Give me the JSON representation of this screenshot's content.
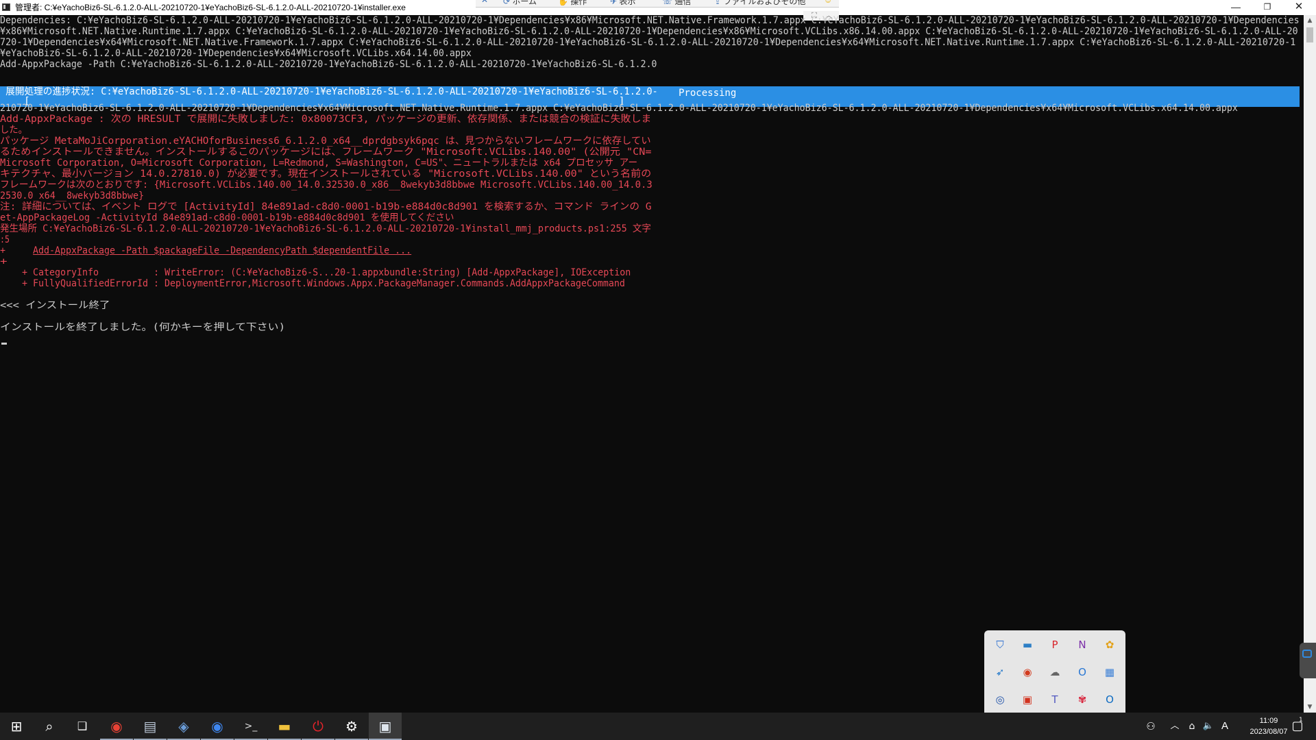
{
  "window": {
    "title": "管理者: C:¥eYachoBiz6-SL-6.1.2.0-ALL-20210720-1¥eYachoBiz6-SL-6.1.2.0-ALL-20210720-1¥installer.exe",
    "minimize_glyph": "—",
    "maximize_glyph": "❐",
    "close_glyph": "✕"
  },
  "remote_toolbar": {
    "items": [
      {
        "glyph": "✕",
        "label": ""
      },
      {
        "glyph": "⟳",
        "label": "ホーム"
      },
      {
        "glyph": "✋",
        "label": "操作"
      },
      {
        "glyph": "✈",
        "label": "表示"
      },
      {
        "glyph": "☏",
        "label": "通信"
      },
      {
        "glyph": "⇪",
        "label": "ファイルおよびその他"
      },
      {
        "glyph": "☺",
        "label": ""
      }
    ],
    "fullscreen_glyph": "⛶",
    "collapse_glyph": "︿"
  },
  "console": {
    "lines": [
      {
        "text": "Dependencies: C:¥eYachoBiz6-SL-6.1.2.0-ALL-20210720-1¥eYachoBiz6-SL-6.1.2.0-ALL-20210720-1¥Dependencies¥x86¥Microsoft.NET.Native.Framework.1.7.appx C:¥eYachoBiz6-SL-6.1.2.0-ALL-20210720-1¥eYachoBiz6-SL-6.1.2.0-ALL-20210720-1¥Dependencies",
        "color": "w"
      },
      {
        "text": "¥x86¥Microsoft.NET.Native.Runtime.1.7.appx C:¥eYachoBiz6-SL-6.1.2.0-ALL-20210720-1¥eYachoBiz6-SL-6.1.2.0-ALL-20210720-1¥Dependencies¥x86¥Microsoft.VCLibs.x86.14.00.appx C:¥eYachoBiz6-SL-6.1.2.0-ALL-20210720-1¥eYachoBiz6-SL-6.1.2.0-ALL-20",
        "color": "w"
      },
      {
        "text": "720-1¥Dependencies¥x64¥Microsoft.NET.Native.Framework.1.7.appx C:¥eYachoBiz6-SL-6.1.2.0-ALL-20210720-1¥eYachoBiz6-SL-6.1.2.0-ALL-20210720-1¥Dependencies¥x64¥Microsoft.NET.Native.Runtime.1.7.appx C:¥eYachoBiz6-SL-6.1.2.0-ALL-20210720-1",
        "color": "w"
      },
      {
        "text": "¥eYachoBiz6-SL-6.1.2.0-ALL-20210720-1¥Dependencies¥x64¥Microsoft.VCLibs.x64.14.00.appx",
        "color": "w"
      },
      {
        "text": "Add-AppxPackage -Path C:¥eYachoBiz6-SL-6.1.2.0-ALL-20210720-1¥eYachoBiz6-SL-6.1.2.0-ALL-20210720-1¥eYachoBiz6-SL-6.1.2.0",
        "color": "w"
      },
      {
        "text": "",
        "color": "w"
      },
      {
        "text": "",
        "color": "w"
      },
      {
        "text": "",
        "color": "w"
      },
      {
        "text": "210720-1¥eYachoBiz6-SL-6.1.2.0-ALL-20210720-1¥Dependencies¥x64¥Microsoft.NET.Native.Runtime.1.7.appx C:¥eYachoBiz6-SL-6.1.2.0-ALL-20210720-1¥eYachoBiz6-SL-6.1.2.0-ALL-20210720-1¥Dependencies¥x64¥Microsoft.VCLibs.x64.14.00.appx",
        "color": "w"
      },
      {
        "text": "Add-AppxPackage : 次の HRESULT で展開に失敗しました: 0x80073CF3, パッケージの更新、依存関係、または競合の検証に失敗しま",
        "color": "r"
      },
      {
        "text": "した。",
        "color": "r"
      },
      {
        "text": "パッケージ MetaMoJiCorporation.eYACHOforBusiness6_6.1.2.0_x64__dprdgbsyk6pqc は、見つからないフレームワークに依存してい",
        "color": "r"
      },
      {
        "text": "るためインストールできません。インストールするこのパッケージには、フレームワーク \"Microsoft.VCLibs.140.00\" (公開元 \"CN=",
        "color": "r"
      },
      {
        "text": "Microsoft Corporation, O=Microsoft Corporation, L=Redmond, S=Washington, C=US\"、ニュートラルまたは x64 プロセッサ アー",
        "color": "r"
      },
      {
        "text": "キテクチャ、最小バージョン 14.0.27810.0) が必要です。現在インストールされている \"Microsoft.VCLibs.140.00\" という名前の",
        "color": "r"
      },
      {
        "text": "フレームワークは次のとおりです: {Microsoft.VCLibs.140.00_14.0.32530.0_x86__8wekyb3d8bbwe Microsoft.VCLibs.140.00_14.0.3",
        "color": "r"
      },
      {
        "text": "2530.0_x64__8wekyb3d8bbwe}",
        "color": "r"
      },
      {
        "text": "注: 詳細については、イベント ログで [ActivityId] 84e891ad-c8d0-0001-b19b-e884d0c8d901 を検索するか、コマンド ラインの G",
        "color": "r"
      },
      {
        "text": "et-AppPackageLog -ActivityId 84e891ad-c8d0-0001-b19b-e884d0c8d901 を使用してください",
        "color": "r"
      },
      {
        "text": "発生場所 C:¥eYachoBiz6-SL-6.1.2.0-ALL-20210720-1¥eYachoBiz6-SL-6.1.2.0-ALL-20210720-1¥install_mmj_products.ps1:255 文字",
        "color": "r"
      },
      {
        "text": ":5",
        "color": "r"
      },
      {
        "text": "+     Add-AppxPackage -Path $packageFile -DependencyPath $dependentFile ...",
        "color": "r",
        "underline_from": 6
      },
      {
        "text": "+",
        "color": "r"
      },
      {
        "text": "    + CategoryInfo          : WriteError: (C:¥eYachoBiz6-S...20-1.appxbundle:String) [Add-AppxPackage], IOException",
        "color": "r"
      },
      {
        "text": "    + FullyQualifiedErrorId : DeploymentError,Microsoft.Windows.Appx.PackageManager.Commands.AddAppxPackageCommand",
        "color": "r"
      },
      {
        "text": "",
        "color": "w"
      },
      {
        "text": "<<< インストール終了",
        "color": "w"
      },
      {
        "text": "",
        "color": "w"
      },
      {
        "text": "インストールを終了しました。(何かキーを押して下さい)",
        "color": "w"
      }
    ],
    "progress": {
      "line1": " 展開処理の進捗状況: C:¥eYachoBiz6-SL-6.1.2.0-ALL-20210720-1¥eYachoBiz6-SL-6.1.2.0-ALL-20210720-1¥eYachoBiz6-SL-6.1.2.0-",
      "line2": "    [                                                                                                  ]",
      "status": "Processing",
      "color": "#2b8fe4"
    }
  },
  "scrollbar": {
    "up": "▲",
    "down": "▼"
  },
  "tray_popup": {
    "icons": [
      {
        "name": "defender-shield-icon",
        "glyph": "⛉",
        "color": "#2a6fd1"
      },
      {
        "name": "display-icon",
        "glyph": "▬",
        "color": "#2d7fc6"
      },
      {
        "name": "pdf-app-icon",
        "glyph": "P",
        "color": "#d8262d"
      },
      {
        "name": "onenote-icon",
        "glyph": "N",
        "color": "#7b2ea8"
      },
      {
        "name": "sync-app-icon",
        "glyph": "✿",
        "color": "#e3a21a"
      },
      {
        "name": "bird-app-icon",
        "glyph": "➶",
        "color": "#1c74c9"
      },
      {
        "name": "video-app-icon",
        "glyph": "◉",
        "color": "#d23b1e"
      },
      {
        "name": "cloud-drive-icon",
        "glyph": "☁",
        "color": "#666666"
      },
      {
        "name": "outlook-calendar-icon",
        "glyph": "O",
        "color": "#2a78d4"
      },
      {
        "name": "grid-app-icon",
        "glyph": "▦",
        "color": "#3a7fd6"
      },
      {
        "name": "network-app-icon",
        "glyph": "◎",
        "color": "#1b4fa8"
      },
      {
        "name": "gift-app-icon",
        "glyph": "▣",
        "color": "#d2321e"
      },
      {
        "name": "teams-icon",
        "glyph": "T",
        "color": "#5158c0"
      },
      {
        "name": "flower-app-icon",
        "glyph": "✾",
        "color": "#d8243c"
      },
      {
        "name": "outlook-icon",
        "glyph": "O",
        "color": "#0f6cc2"
      },
      {
        "name": "remote-app-icon",
        "glyph": "⊟",
        "color": "#0d5c9e"
      },
      {
        "name": "wechat-icon",
        "glyph": "●",
        "color": "#2ec45a"
      },
      {
        "name": "bluetooth-icon",
        "glyph": "ᛒ",
        "color": "#1f6fd0"
      },
      {
        "name": "update-icon",
        "glyph": "◌",
        "color": "#3a8fde"
      }
    ]
  },
  "taskbar": {
    "start_glyph": "⊞",
    "search_glyph": "⌕",
    "taskview_glyph": "❑",
    "apps": [
      {
        "name": "chrome-taskbar-icon",
        "glyph": "◉",
        "color": "#e94235",
        "active": false
      },
      {
        "name": "explorer-printer-icon",
        "glyph": "▤",
        "color": "#b9c6d6",
        "active": false
      },
      {
        "name": "app-frame-icon",
        "glyph": "◈",
        "color": "#6a9cd8",
        "active": false
      },
      {
        "name": "chrome-profile-icon",
        "glyph": "◉",
        "color": "#3f87f0",
        "active": false
      },
      {
        "name": "terminal-icon",
        "glyph": ">_",
        "color": "#dddddd",
        "active": false
      },
      {
        "name": "file-explorer-icon",
        "glyph": "▬",
        "color": "#f0c23c",
        "active": false
      },
      {
        "name": "power-app-icon",
        "glyph": "⏻",
        "color": "#e8242b",
        "active": false
      },
      {
        "name": "settings-icon",
        "glyph": "⚙",
        "color": "#ffffff",
        "active": false
      },
      {
        "name": "console-window-icon",
        "glyph": "▣",
        "color": "#dfe6ee",
        "active": true
      }
    ],
    "sys": {
      "people_glyph": "⚇",
      "overflow_glyph": "︿",
      "network_glyph": "⌂",
      "volume_glyph": "🔈",
      "ime_label": "A",
      "notification_glyph": "▢",
      "notification_count": "1"
    },
    "clock": {
      "time": "11:09",
      "date": "2023/08/07"
    }
  }
}
